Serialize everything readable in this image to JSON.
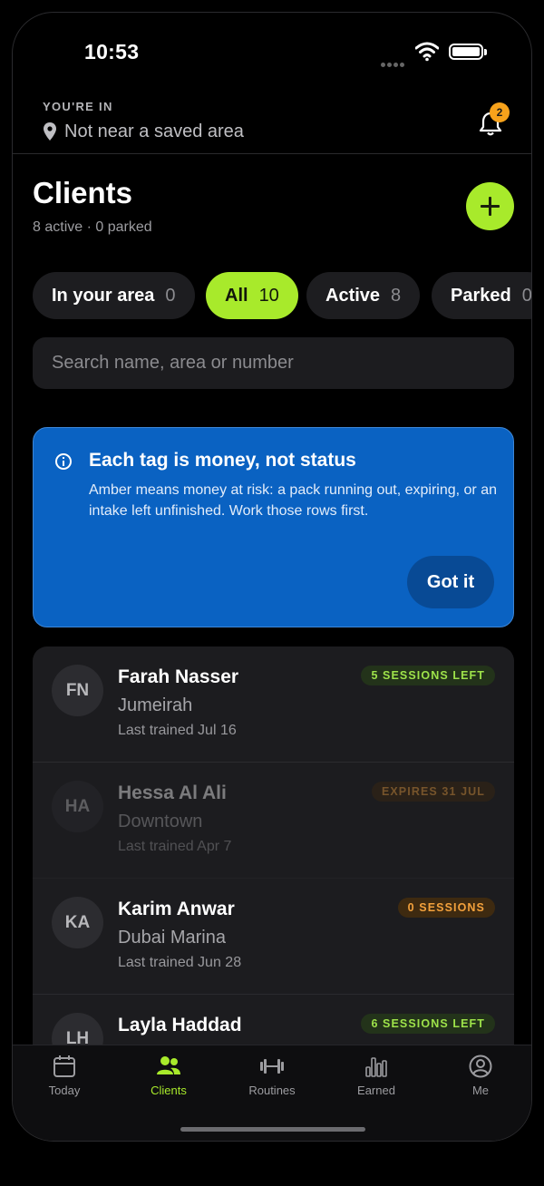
{
  "status_bar": {
    "time": "10:53"
  },
  "location": {
    "eyebrow": "YOU'RE IN",
    "value": "Not near a saved area",
    "notification_count": "2"
  },
  "header": {
    "title": "Clients",
    "subtitle": "8 active · 0 parked"
  },
  "filters": [
    {
      "label": "In your area",
      "count": "0",
      "active": false
    },
    {
      "label": "All",
      "count": "10",
      "active": true
    },
    {
      "label": "Active",
      "count": "8",
      "active": false
    },
    {
      "label": "Parked",
      "count": "0",
      "active": false
    }
  ],
  "search": {
    "placeholder": "Search name, area or number",
    "value": ""
  },
  "tip": {
    "title": "Each tag is money, not status",
    "body": "Amber means money at risk: a pack running out, expiring, or an intake left unfinished. Work those rows first.",
    "button": "Got it"
  },
  "clients": [
    {
      "initials": "FN",
      "name": "Farah Nasser",
      "area": "Jumeirah",
      "last": "Last trained Jul 16",
      "tag": "5 SESSIONS LEFT",
      "tag_color": "green",
      "dim": false
    },
    {
      "initials": "HA",
      "name": "Hessa Al Ali",
      "area": "Downtown",
      "last": "Last trained Apr 7",
      "tag": "EXPIRES 31 JUL",
      "tag_color": "amber",
      "dim": true
    },
    {
      "initials": "KA",
      "name": "Karim Anwar",
      "area": "Dubai Marina",
      "last": "Last trained Jun 28",
      "tag": "0 SESSIONS",
      "tag_color": "amber",
      "dim": false
    },
    {
      "initials": "LH",
      "name": "Layla Haddad",
      "area": "",
      "last": "",
      "tag": "6 SESSIONS LEFT",
      "tag_color": "green",
      "dim": false
    }
  ],
  "tabs": [
    {
      "label": "Today",
      "icon": "calendar-icon",
      "active": false
    },
    {
      "label": "Clients",
      "icon": "people-icon",
      "active": true
    },
    {
      "label": "Routines",
      "icon": "dumbbell-icon",
      "active": false
    },
    {
      "label": "Earned",
      "icon": "bar-chart-icon",
      "active": false
    },
    {
      "label": "Me",
      "icon": "profile-icon",
      "active": false
    }
  ],
  "colors": {
    "accent": "#a8ea2b",
    "tip_bg": "#0a62c2",
    "amber": "#f3a13c",
    "badge": "#f7a21b"
  }
}
